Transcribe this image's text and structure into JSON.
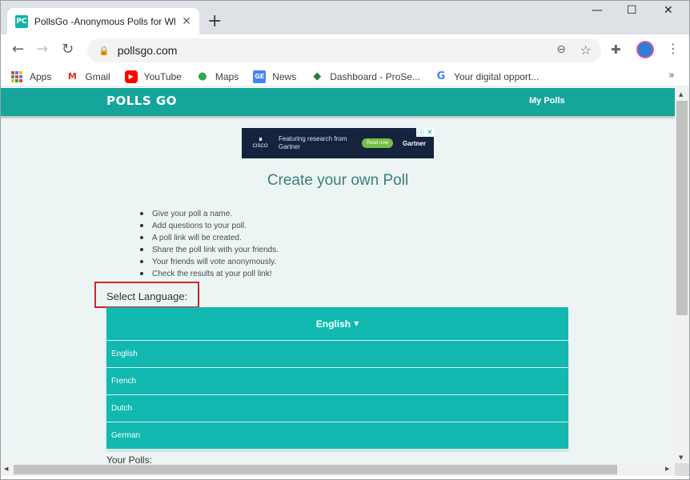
{
  "browser": {
    "tab_title": "PollsGo -Anonymous Polls for WhatsApp",
    "favicon_text": "PC",
    "tab_close": "✕",
    "new_tab": "+",
    "min": "—",
    "max": "☐",
    "close": "✕",
    "back": "←",
    "forward": "→",
    "reload": "↻",
    "url": "pollsgo.com",
    "more_bookmarks": "»",
    "bookmarks": [
      {
        "label": "Apps",
        "icon": "apps-grid-icon"
      },
      {
        "label": "Gmail",
        "icon": "gmail-icon"
      },
      {
        "label": "YouTube",
        "icon": "youtube-icon"
      },
      {
        "label": "Maps",
        "icon": "maps-pin-icon"
      },
      {
        "label": "News",
        "icon": "news-icon"
      },
      {
        "label": "Dashboard - ProSe...",
        "icon": "prosearch-icon"
      },
      {
        "label": "Your digital opport...",
        "icon": "google-icon"
      }
    ]
  },
  "site": {
    "logo": "POLLS GO",
    "my_polls": "My Polls",
    "ad": {
      "brand": "CISCO",
      "text": "Featuring research from Gartner",
      "cta": "Read now",
      "partner": "Gartner",
      "info": "ⓘ",
      "close": "✕"
    },
    "heading": "Create your own Poll",
    "steps": [
      "Give your poll a name.",
      "Add questions to your poll.",
      "A poll link will be created.",
      "Share the poll link with your friends.",
      "Your friends will vote anonymously.",
      "Check the results at your poll link!"
    ],
    "select_language_label": "Select Language:",
    "selected_language": "English",
    "language_options": [
      "English",
      "French",
      "Dutch",
      "German"
    ],
    "your_polls_label": "Your Polls:"
  },
  "colors": {
    "brand_teal": "#16a59a",
    "dropdown_teal": "#11b9b0",
    "highlight_red": "#d6202a"
  }
}
